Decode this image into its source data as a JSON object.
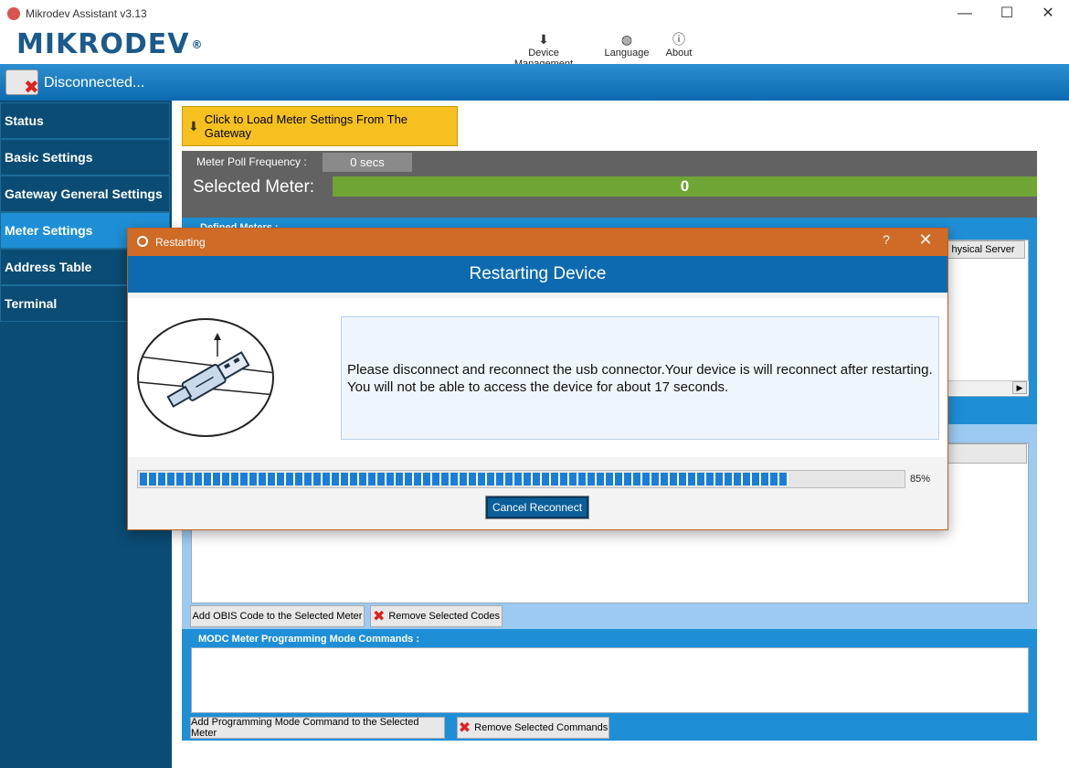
{
  "window": {
    "title": "Mikrodev Assistant v3.13",
    "controls": {
      "minimize": "—",
      "maximize": "☐",
      "close": "✕"
    }
  },
  "header": {
    "logo": "MIKRODEV",
    "logo_mark": "®",
    "buttons": [
      {
        "label": "Device Management",
        "icon": "download-icon"
      },
      {
        "label": "Language",
        "icon": "globe-icon"
      },
      {
        "label": "About",
        "icon": "info-icon"
      }
    ]
  },
  "status": {
    "text": "Disconnected..."
  },
  "sidebar": {
    "items": [
      {
        "label": "Status"
      },
      {
        "label": "Basic Settings"
      },
      {
        "label": "Gateway General Settings"
      },
      {
        "label": "Meter Settings",
        "active": true
      },
      {
        "label": "Address Table"
      },
      {
        "label": "Terminal"
      }
    ]
  },
  "main": {
    "load_button": "Click to Load Meter Settings From The Gateway",
    "poll_label": "Meter Poll Frequency :",
    "poll_value": "0 secs",
    "selected_label": "Selected Meter:",
    "selected_value": "0",
    "defined_meters_label": "Defined Meters :",
    "physical_server_button": "hysical Server",
    "add_obis_button": "Add OBIS Code to the Selected Meter",
    "remove_codes_button": "Remove Selected Codes",
    "modc_label": "MODC Meter Programming Mode Commands :",
    "add_prog_button": "Add Programming Mode Command to the Selected Meter",
    "remove_commands_button": "Remove Selected Commands"
  },
  "dialog": {
    "title": "Restarting",
    "help": "?",
    "close": "✕",
    "header": "Restarting Device",
    "message": "Please disconnect and reconnect  the usb connector.Your device is will reconnect after restarting. You will not be able to access the device for about 17 seconds.",
    "progress": 0.85,
    "progress_text": "85%",
    "cancel_button": "Cancel Reconnect"
  },
  "colors": {
    "accent": "#1e8fd6",
    "sidebar": "#0b4c74",
    "dialog_title": "#cf6b26",
    "load_button": "#f5c020",
    "selected_value": "#6fa535"
  }
}
